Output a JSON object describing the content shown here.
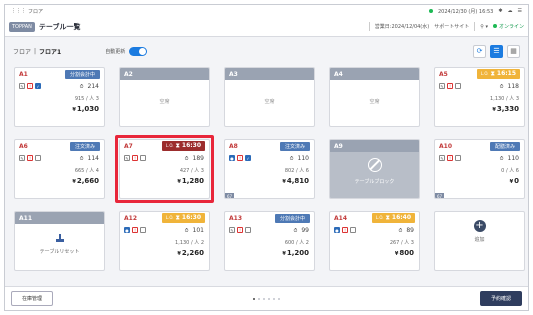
{
  "sysbar": {
    "app_name": "フロア",
    "datetime": "2024/12/30 (月) 16:53"
  },
  "header": {
    "badge": "TOPPAN",
    "title": "テーブル一覧",
    "business_date": "営業日:2024/12/04(水)",
    "support_site": "サポートサイト",
    "menu_label": "",
    "online_label": "オンライン"
  },
  "toolbar": {
    "breadcrumb_root": "フロア",
    "breadcrumb_current": "フロア1",
    "auto_update_label": "自動更新"
  },
  "tables": [
    {
      "id": "A1",
      "status": "分割会計中",
      "guests": "214",
      "sub": "915 / 人 3",
      "amount": "1,030"
    },
    {
      "id": "A2",
      "empty": "空席"
    },
    {
      "id": "A3",
      "empty": "空席"
    },
    {
      "id": "A4",
      "empty": "空席"
    },
    {
      "id": "A5",
      "time": "16:15",
      "guests": "118",
      "sub": "1,130 / 人 3",
      "amount": "3,330"
    },
    {
      "id": "A6",
      "status": "注文済み",
      "guests": "114",
      "sub": "665 / 人 4",
      "amount": "2,660"
    },
    {
      "id": "A7",
      "time": "16:30",
      "guests": "189",
      "sub": "427 / 人 3",
      "amount": "1,280"
    },
    {
      "id": "A8",
      "status": "注文済み",
      "guests": "110",
      "sub": "802 / 人 6",
      "amount": "4,810",
      "corner": "67"
    },
    {
      "id": "A9",
      "block": "テーブルブロック"
    },
    {
      "id": "A10",
      "status": "配膳済み",
      "guests": "110",
      "sub": "0 / 人 6",
      "amount": "0",
      "corner": "67"
    },
    {
      "id": "A11",
      "reset": "テーブルリセット"
    },
    {
      "id": "A12",
      "time": "16:30",
      "guests": "101",
      "sub": "1,130 / 人 2",
      "amount": "2,260"
    },
    {
      "id": "A13",
      "status": "分割会計中",
      "guests": "99",
      "sub": "600 / 人 2",
      "amount": "1,200"
    },
    {
      "id": "A14",
      "time": "16:40",
      "guests": "89",
      "sub": "267 / 人 3",
      "amount": "800"
    },
    {
      "add": "追加"
    }
  ],
  "footer": {
    "left_button": "在庫管理",
    "right_button": "予約確認"
  }
}
